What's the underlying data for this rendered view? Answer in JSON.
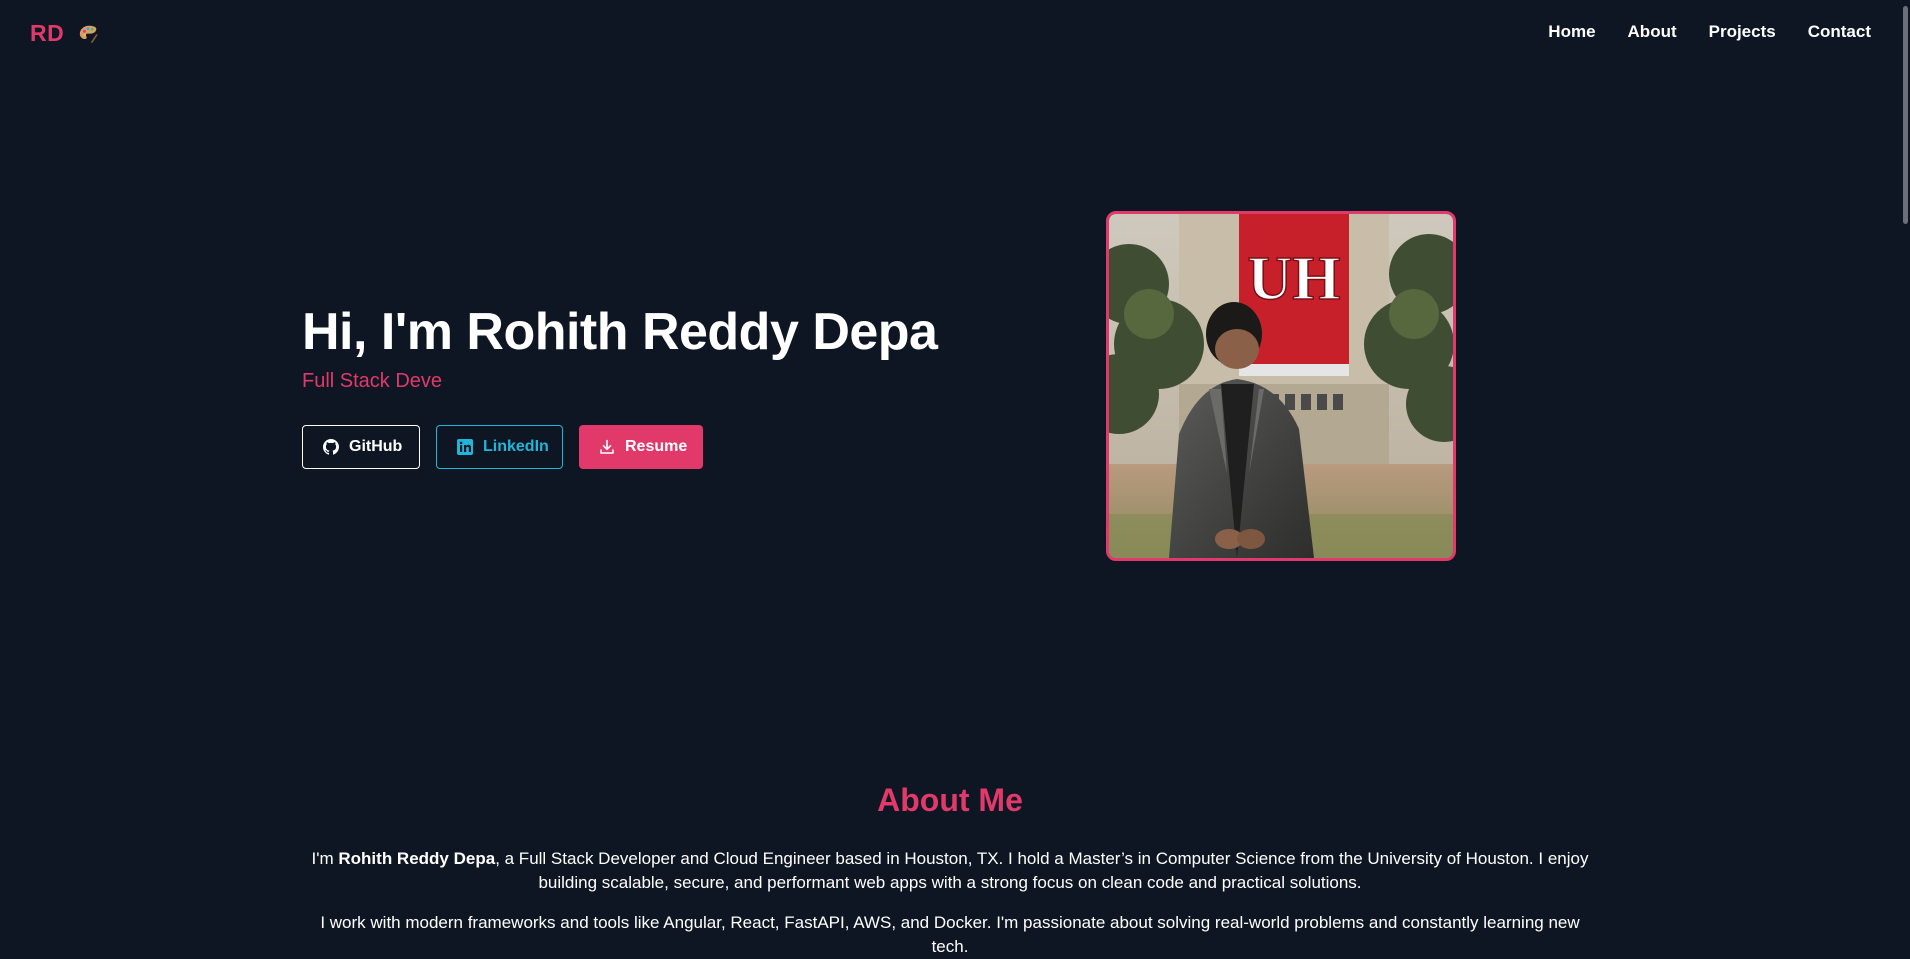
{
  "nav": {
    "logo": "RD",
    "logo_icon": "palette-icon",
    "links": [
      "Home",
      "About",
      "Projects",
      "Contact"
    ]
  },
  "hero": {
    "title": "Hi, I'm Rohith Reddy Depa",
    "subtitle": "Full Stack Deve",
    "buttons": {
      "github": {
        "label": "GitHub",
        "icon": "github-icon"
      },
      "linkedin": {
        "label": "LinkedIn",
        "icon": "linkedin-icon"
      },
      "resume": {
        "label": "Resume",
        "icon": "download-icon"
      }
    },
    "photo": {
      "description_icon": "profile-photo",
      "banner_text": "UH"
    }
  },
  "about": {
    "title": "About Me",
    "p1_before": "I'm ",
    "p1_name": "Rohith Reddy Depa",
    "p1_after": ", a Full Stack Developer and Cloud Engineer based in Houston, TX. I hold a Master’s in Computer Science from the University of Houston. I enjoy building scalable, secure, and performant web apps with a strong focus on clean code and practical solutions.",
    "p2": "I work with modern frameworks and tools like Angular, React, FastAPI, AWS, and Docker. I'm passionate about solving real-world problems and constantly learning new tech."
  },
  "colors": {
    "background": "#0f1623",
    "accent": "#e0396a",
    "linkedin": "#1fb6d9",
    "text": "#ffffff"
  }
}
